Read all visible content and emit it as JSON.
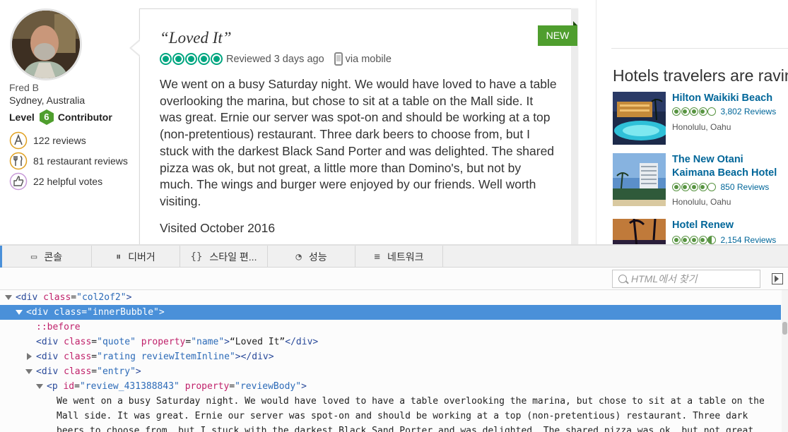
{
  "member": {
    "name": "Fred B",
    "location": "Sydney, Australia",
    "level_prefix": "Level",
    "level_number": "6",
    "level_suffix": "Contributor",
    "stats": [
      {
        "icon": "pen-badge-icon",
        "label": "122 reviews"
      },
      {
        "icon": "fork-knife-icon",
        "label": "81 restaurant reviews"
      },
      {
        "icon": "thumbs-up-icon",
        "label": "22 helpful votes"
      }
    ]
  },
  "review": {
    "new_tag": "NEW",
    "quote": "“Loved It”",
    "rating_bubbles": 5,
    "reviewed": "Reviewed 3 days ago",
    "via": "via mobile",
    "body_lines": [
      "We went on a busy Saturday night. We would have loved to have a table",
      "overlooking the marina, but chose to sit at a table on the Mall side. It",
      "was great. Ernie our server was spot-on and should be working at a top",
      "(non-pretentious) restaurant. Three dark beers to choose from, but I",
      "stuck with the darkest Black Sand Porter and was delighted. The shared",
      "pizza was ok, but not great, a little more than Domino's, but not by",
      "much. The wings and burger were enjoyed by our friends. Well worth",
      "visiting."
    ],
    "visited": "Visited October 2016"
  },
  "hotels": {
    "title": "Hotels travelers are raving about",
    "items": [
      {
        "name": "Hilton Waikiki Beach",
        "rating": 4,
        "reviews": "3,802 Reviews",
        "location": "Honolulu, Oahu"
      },
      {
        "name": "The New Otani Kaimana Beach Hotel",
        "rating": 4,
        "reviews": "850 Reviews",
        "location": "Honolulu, Oahu"
      },
      {
        "name": "Hotel Renew",
        "rating": 4.5,
        "reviews": "2,154 Reviews",
        "location": ""
      }
    ]
  },
  "devtools": {
    "tabs": [
      {
        "icon": "console-icon",
        "label": "콘솔"
      },
      {
        "icon": "debugger-icon",
        "label": "디버거"
      },
      {
        "icon": "style-editor-icon",
        "label": "스타일 편..."
      },
      {
        "icon": "performance-icon",
        "label": "성능"
      },
      {
        "icon": "network-icon",
        "label": "네트워크"
      }
    ],
    "search_placeholder": "HTML에서 찾기",
    "tree": {
      "n0": {
        "tag": "div",
        "attr": "class",
        "value": "col2of2"
      },
      "n1": {
        "tag": "div",
        "attr": "class",
        "value": "innerBubble"
      },
      "n2": {
        "pseudo": "::before"
      },
      "n3": {
        "tag": "div",
        "attr1": "class",
        "value1": "quote",
        "attr2": "property",
        "value2": "name",
        "text": "“Loved It”",
        "close": "div"
      },
      "n4": {
        "tag": "div",
        "attr": "class",
        "value": "rating reviewItemInline",
        "close": "div"
      },
      "n5": {
        "tag": "div",
        "attr": "class",
        "value": "entry"
      },
      "n6": {
        "tag": "p",
        "attr1": "id",
        "value1": "review_431388843",
        "attr2": "property",
        "value2": "reviewBody"
      },
      "text_lines": [
        "We went on a busy Saturday night. We would have loved to have a table overlooking the marina, but chose to sit at a table on the",
        "Mall side. It was great. Ernie our server was spot-on and should be working at a top (non-pretentious) restaurant. Three dark",
        "beers to choose from, but I stuck with the darkest Black Sand Porter and was delighted. The shared pizza was ok, but not great,"
      ]
    }
  },
  "colors": {
    "tripadvisor_green": "#00a680",
    "new_tag_green": "#4f9e2e",
    "hotel_link_blue": "#006699",
    "devtools_selection": "#4a90d9"
  }
}
